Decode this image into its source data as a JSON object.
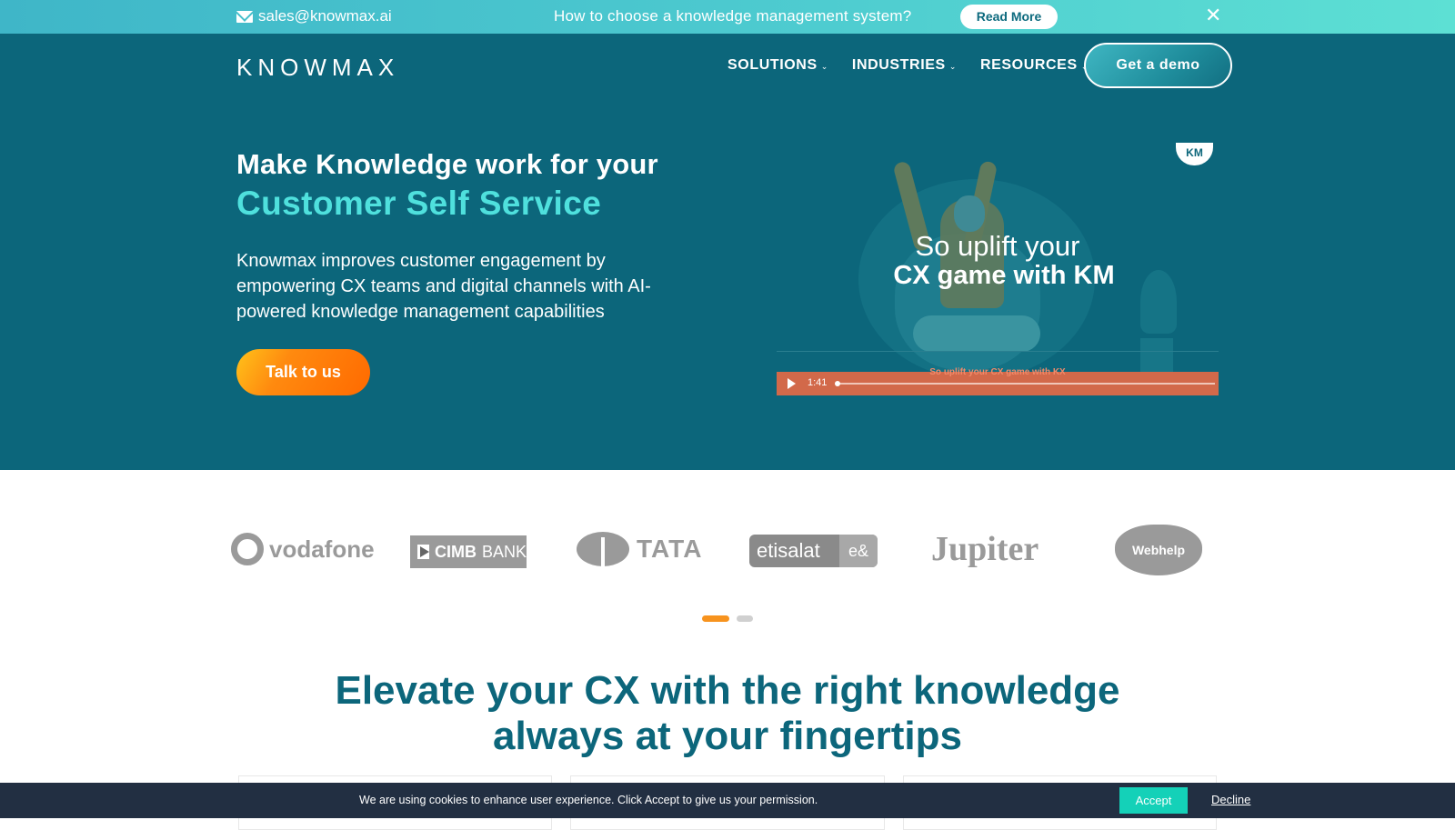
{
  "announcement": {
    "email_icon": "envelope-icon",
    "email": "sales@knowmax.ai",
    "promo_text": "How to choose a knowledge management system?",
    "read_more_label": "Read More",
    "close_icon": "close-icon",
    "close_glyph": "✕"
  },
  "header": {
    "logo": "KNOWMAX",
    "nav": [
      {
        "label": "SOLUTIONS",
        "chevron": "⌄"
      },
      {
        "label": "INDUSTRIES",
        "chevron": "⌄"
      },
      {
        "label": "RESOURCES",
        "chevron": "⌄"
      }
    ],
    "cta_label": "Get a demo"
  },
  "hero": {
    "title_line1": "Make Knowledge work for your",
    "title_line2": "Customer Self Service",
    "description": "Knowmax improves customer engagement by empowering CX teams and digital channels with AI-powered knowledge management capabilities",
    "cta_label": "Talk to us",
    "video": {
      "badge": "KM",
      "caption_line1": "So uplift your",
      "caption_line2": "CX game with KM",
      "subtitle": "So uplift your CX game with KX",
      "duration": "1:41",
      "progress": 0
    }
  },
  "clients": {
    "logos": [
      "vodafone",
      "CIMB BANK",
      "TATA",
      "etisalat by e&",
      "Jupiter",
      "Webhelp"
    ],
    "cimb_bold": "CIMB",
    "cimb_light": "BANK",
    "etisalat_main": "etisalat",
    "etisalat_by": "e&",
    "carousel_pages": 2,
    "carousel_active": 1
  },
  "section": {
    "title_line1": "Elevate your CX with the right knowledge",
    "title_line2": "always at your fingertips"
  },
  "cookie": {
    "message": "We are using cookies to enhance user experience. Click Accept to give us your permission.",
    "accept_label": "Accept",
    "decline_label": "Decline"
  },
  "colors": {
    "brand_teal": "#0c667b",
    "accent_cyan": "#4fe0dd",
    "cta_orange": "#ff6a00",
    "cookie_bg": "#222f42",
    "accept_green": "#14d1b8"
  }
}
